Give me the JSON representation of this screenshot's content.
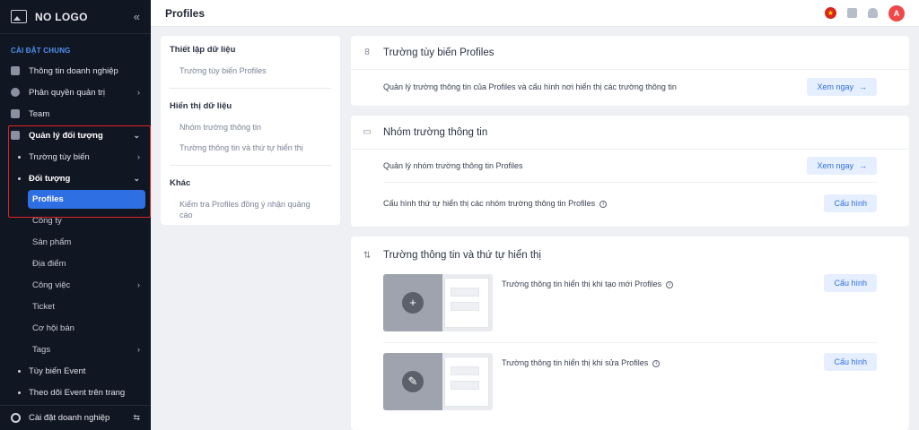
{
  "sidebar": {
    "logo": "NO LOGO",
    "collapse_icon": "«",
    "section_title": "CÀI ĐẶT CHUNG",
    "items": [
      {
        "label": "Thông tin doanh nghiệp"
      },
      {
        "label": "Phân quyền quản trị"
      },
      {
        "label": "Team"
      },
      {
        "label": "Quản lý đối tượng"
      },
      {
        "label": "Trường tùy biến"
      },
      {
        "label": "Đối tượng"
      },
      {
        "label": "Profiles"
      },
      {
        "label": "Công ty"
      },
      {
        "label": "Sản phẩm"
      },
      {
        "label": "Địa điểm"
      },
      {
        "label": "Công việc"
      },
      {
        "label": "Ticket"
      },
      {
        "label": "Cơ hội bán"
      },
      {
        "label": "Tags"
      },
      {
        "label": "Tùy biến Event"
      },
      {
        "label": "Theo dõi Event trên trang"
      }
    ],
    "footer": "Cài đặt doanh nghiệp",
    "footer_icon": "⇆"
  },
  "topbar": {
    "title": "Profiles",
    "flag": "★",
    "avatar": "A"
  },
  "subnav": {
    "groups": [
      {
        "title": "Thiết lập dữ liệu",
        "links": [
          "Trường tùy biến Profiles"
        ]
      },
      {
        "title": "Hiển thị dữ liệu",
        "links": [
          "Nhóm trường thông tin",
          "Trường thông tin và thứ tự hiển thị"
        ]
      },
      {
        "title": "Khác",
        "links": [
          "Kiểm tra Profiles đồng ý nhận quảng cáo"
        ]
      }
    ]
  },
  "cards": {
    "custom_fields": {
      "title": "Trường tùy biến Profiles",
      "icon": "8",
      "row_text": "Quản lý trường thông tin của Profiles và cấu hình nơi hiển thị các trường thông tin",
      "button": "Xem ngay"
    },
    "field_groups": {
      "title": "Nhóm trường thông tin",
      "rows": [
        {
          "text": "Quản lý nhóm trường thông tin Profiles",
          "button": "Xem ngay"
        },
        {
          "text": "Cấu hình thứ tự hiển thị các nhóm trường thông tin Profiles",
          "button": "Cấu hình"
        }
      ]
    },
    "field_order": {
      "title": "Trường thông tin và thứ tự hiển thị",
      "icon": "⇅",
      "rows": [
        {
          "text": "Trường thông tin hiển thị khi tạo mới Profiles",
          "button": "Cấu hình",
          "thumb_icon": "+"
        },
        {
          "text": "Trường thông tin hiển thị khi sửa Profiles",
          "button": "Cấu hình",
          "thumb_icon": "✎"
        }
      ]
    }
  },
  "colors": {
    "sidebar_bg": "#111623",
    "accent": "#2f6fe4",
    "highlight": "#e02020",
    "avatar": "#ef4848"
  }
}
